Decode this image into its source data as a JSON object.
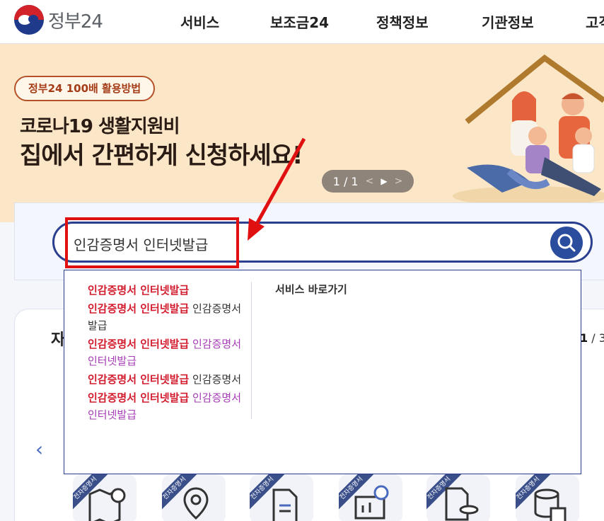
{
  "header": {
    "logo_text": "정부24",
    "nav": [
      "서비스",
      "보조금24",
      "정책정보",
      "기관정보",
      "고객"
    ]
  },
  "banner": {
    "pill_label": "정부24 100배 활용방법",
    "title_line1": "코로나19 생활지원비",
    "title_line2": "집에서 간편하게 신청하세요!",
    "pager": "1 / 1",
    "prev_symbol": "<",
    "play_symbol": "▶",
    "next_symbol": ">"
  },
  "search": {
    "value": "인감증명서 인터넷발급",
    "dropdown": {
      "suggestions": [
        {
          "match": "인감증명서 인터넷발급",
          "rest": "",
          "rest_style": "dark"
        },
        {
          "match": "인감증명서 인터넷발급",
          "rest": " 인감증명서 발급",
          "rest_style": "dark"
        },
        {
          "match": "인감증명서 인터넷발급",
          "rest": " 인감증명서 인터넷발급",
          "rest_style": "purple"
        },
        {
          "match": "인감증명서 인터넷발급",
          "rest": " 인감증명서",
          "rest_style": "dark"
        },
        {
          "match": "인감증명서 인터넷발급",
          "rest": " 인감증명서 인터넷발급",
          "rest_style": "purple"
        }
      ],
      "shortcut_title": "서비스 바로가기"
    }
  },
  "lower": {
    "title_partial": "자",
    "page_current": "1",
    "page_total_partial": "/ 3",
    "ribbon_label": "전자증명서",
    "left_arrow": "‹"
  },
  "colors": {
    "brand_navy": "#2b3f8f",
    "highlight_red": "#e01010",
    "match_red": "#d21b2d",
    "suggest_purple": "#a63cb5",
    "banner_bg": "#fbe7c8"
  }
}
